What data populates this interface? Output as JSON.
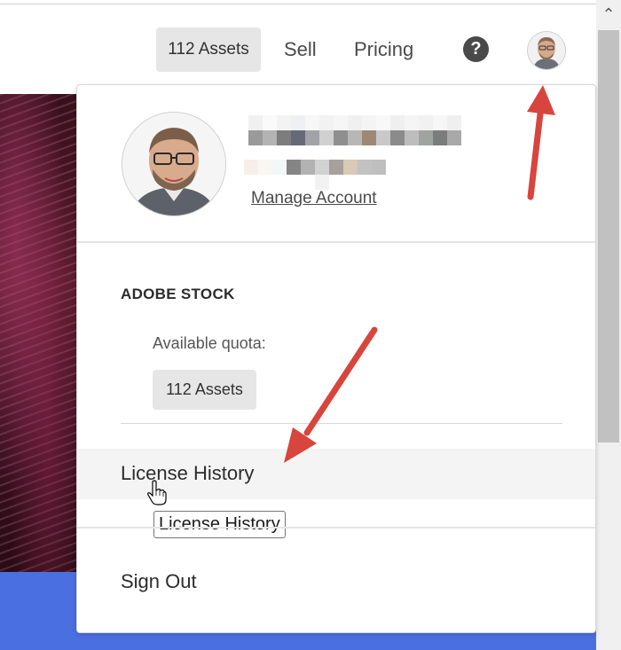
{
  "header": {
    "assets_label": "112 Assets",
    "nav": {
      "sell": "Sell",
      "pricing": "Pricing"
    },
    "help_icon": "question-mark-icon",
    "avatar_icon": "user-avatar-icon"
  },
  "account_menu": {
    "manage_account": "Manage Account",
    "section_title": "ADOBE STOCK",
    "quota_label": "Available quota:",
    "quota_value": "112 Assets",
    "license_history": "License History",
    "tooltip": "License History",
    "sign_out": "Sign Out"
  },
  "colors": {
    "pill_bg": "#e6e6e6",
    "blue_band": "#4a6fe0",
    "arrow": "#d8453d"
  }
}
